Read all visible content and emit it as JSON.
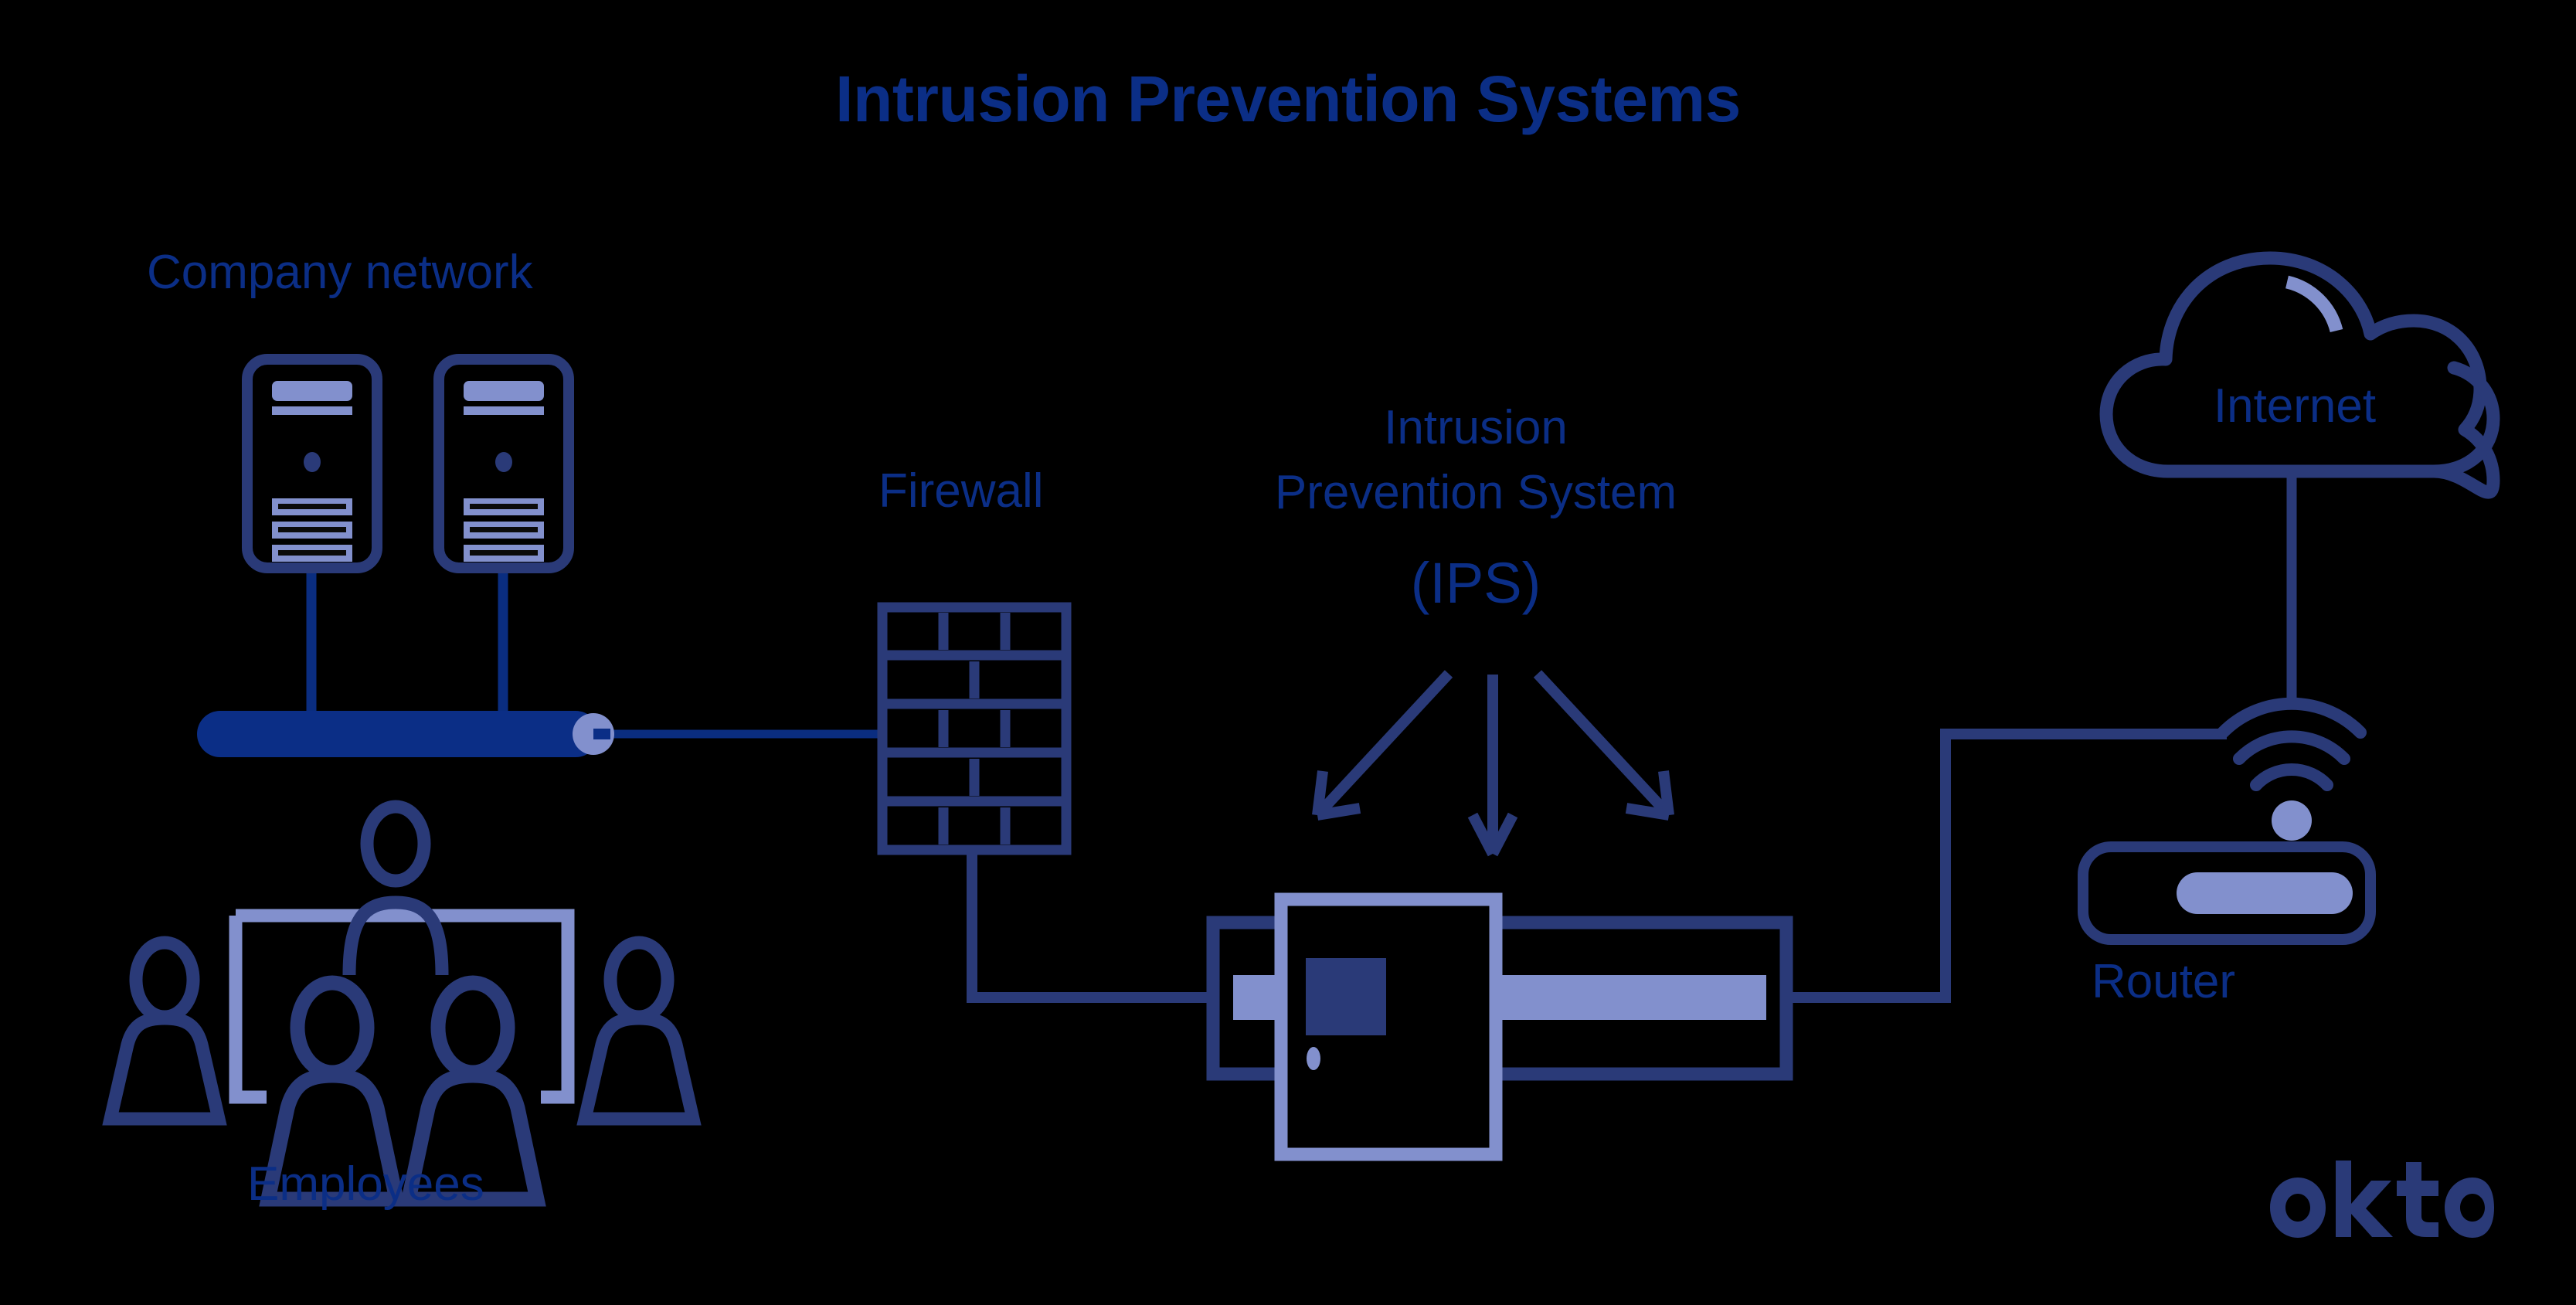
{
  "page": {
    "title": "Intrusion Prevention Systems",
    "background_color": "#000000",
    "brand_logo": "okta"
  },
  "colors": {
    "title_blue": "#0b2e86",
    "label_blue": "#0b2e86",
    "line_dark_navy": "#0a2d80",
    "icon_navy": "#2a3a78",
    "icon_light_periwinkle": "#8290cd",
    "switch_fill": "#0b2e86",
    "okta_navy": "#2a3a78"
  },
  "diagram": {
    "type": "network-architecture",
    "nodes": [
      {
        "id": "company-network",
        "label": "Company network",
        "icon": "two-server-towers",
        "group": "left-zone"
      },
      {
        "id": "network-switch",
        "label": "",
        "icon": "network-switch-bar",
        "group": "left-zone"
      },
      {
        "id": "employees",
        "label": "Employees",
        "icon": "employees-group",
        "group": "left-zone"
      },
      {
        "id": "firewall",
        "label": "Firewall",
        "icon": "brick-wall",
        "group": "middle-zone"
      },
      {
        "id": "ips",
        "label": "Intrusion\nPrevention System",
        "label_abbrev": "(IPS)",
        "icon": "ips-appliance",
        "group": "middle-zone"
      },
      {
        "id": "router",
        "label": "Router",
        "icon": "wifi-router",
        "group": "right-zone"
      },
      {
        "id": "internet",
        "label": "Internet",
        "icon": "cloud",
        "group": "right-zone"
      }
    ],
    "edges": [
      {
        "from": "company-network",
        "to": "network-switch",
        "style": "solid"
      },
      {
        "from": "network-switch",
        "to": "firewall",
        "style": "solid"
      },
      {
        "from": "firewall",
        "to": "ips",
        "style": "solid"
      },
      {
        "from": "ips",
        "to": "router",
        "style": "solid"
      },
      {
        "from": "router",
        "to": "internet",
        "style": "solid"
      }
    ],
    "annotation_arrows": {
      "from": "ips-label",
      "to": "ips-appliance",
      "count": 3,
      "directions": [
        "down-left",
        "down",
        "down-right"
      ]
    }
  },
  "labels": {
    "title": "Intrusion Prevention Systems",
    "company_network": "Company network",
    "employees": "Employees",
    "firewall": "Firewall",
    "ips_line1": "Intrusion",
    "ips_line2": "Prevention System",
    "ips_abbrev": "(IPS)",
    "internet": "Internet",
    "router": "Router",
    "okta": "okta"
  }
}
